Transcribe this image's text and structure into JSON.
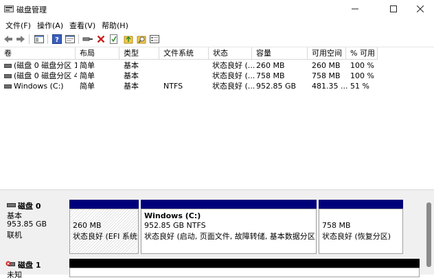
{
  "window": {
    "title": "磁盘管理"
  },
  "menu": [
    "文件(F)",
    "操作(A)",
    "查看(V)",
    "帮助(H)"
  ],
  "toolbar": [
    "back-icon",
    "forward-icon",
    "console-tree-icon",
    "help-icon",
    "properties-icon",
    "connect-icon",
    "delete-icon",
    "check-icon",
    "open-folder-icon",
    "explore-icon",
    "settings-icon"
  ],
  "columns": [
    "卷",
    "布局",
    "类型",
    "文件系统",
    "状态",
    "容量",
    "可用空间",
    "% 可用"
  ],
  "volumes": [
    {
      "name": "(磁盘 0 磁盘分区 1)",
      "layout": "简单",
      "type": "基本",
      "fs": "",
      "status": "状态良好 (...",
      "capacity": "260 MB",
      "free": "260 MB",
      "pct": "100 %"
    },
    {
      "name": "(磁盘 0 磁盘分区 4)",
      "layout": "简单",
      "type": "基本",
      "fs": "",
      "status": "状态良好 (...",
      "capacity": "758 MB",
      "free": "758 MB",
      "pct": "100 %"
    },
    {
      "name": "Windows (C:)",
      "layout": "简单",
      "type": "基本",
      "fs": "NTFS",
      "status": "状态良好 (...",
      "capacity": "952.85 GB",
      "free": "481.35 ...",
      "pct": "51 %"
    }
  ],
  "disks": [
    {
      "name": "磁盘 0",
      "type": "基本",
      "size": "953.85 GB",
      "status": "联机",
      "partitions": [
        {
          "size": "260 MB",
          "status": "状态良好 (EFI 系统分区)"
        },
        {
          "label": "Windows  (C:)",
          "size": "952.85 GB NTFS",
          "status": "状态良好 (启动, 页面文件, 故障转储, 基本数据分区)"
        },
        {
          "size": "758 MB",
          "status": "状态良好 (恢复分区)"
        }
      ]
    },
    {
      "name": "磁盘 1",
      "type": "未知"
    }
  ],
  "colors": {
    "stripe": "#00007a",
    "error": "#d02020"
  }
}
